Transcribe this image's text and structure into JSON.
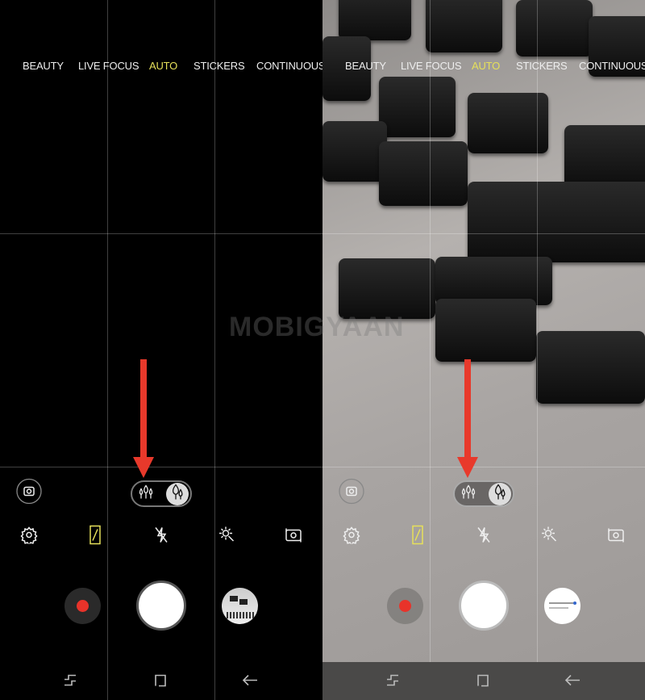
{
  "panels": [
    {
      "theme": "dark",
      "modes": [
        "BEAUTY",
        "LIVE FOCUS",
        "AUTO",
        "STICKERS",
        "CONTINUOUS S"
      ],
      "active_mode": "AUTO"
    },
    {
      "theme": "light",
      "modes": [
        "BEAUTY",
        "LIVE FOCUS",
        "AUTO",
        "STICKERS",
        "CONTINUOUS"
      ],
      "active_mode": "AUTO"
    }
  ],
  "icons": {
    "bixby": "camera-circle-icon",
    "settings": "gear-icon",
    "motion": "motion-photo-icon",
    "flash": "flash-off-icon",
    "effects": "filter-effects-icon",
    "switch": "switch-camera-icon",
    "bokeh_off": "trees-icon",
    "bokeh_on": "droplet-icon"
  },
  "watermark": "MOBIGYAAN",
  "colors": {
    "active_mode": "#e6e05a",
    "record": "#e8332a",
    "arrow": "#e8392b",
    "motion_icon": "#e6e05a"
  }
}
